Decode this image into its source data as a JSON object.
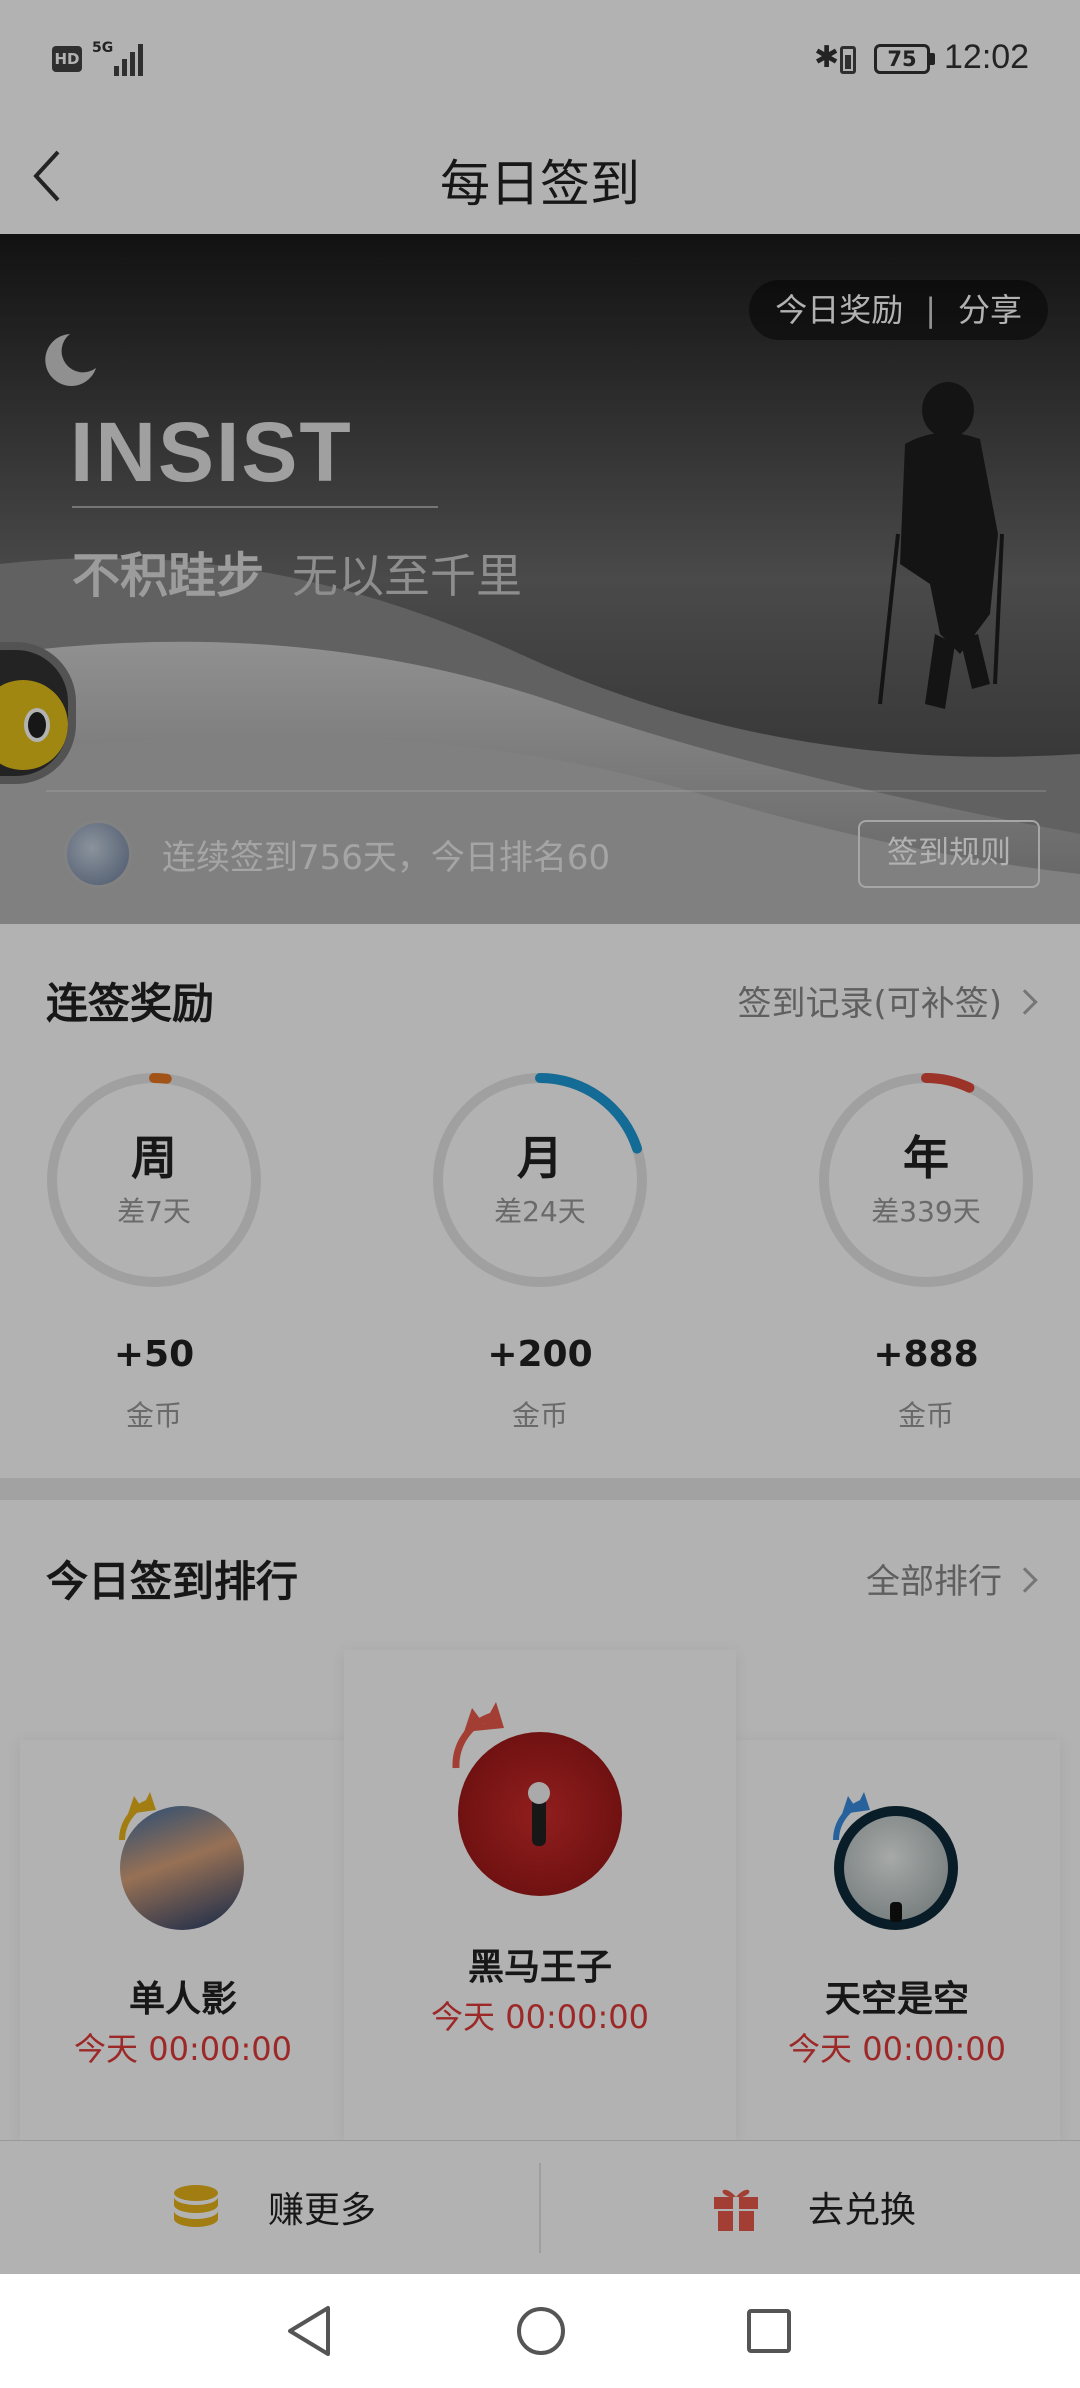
{
  "status_bar": {
    "hd": "HD",
    "network": "5G",
    "battery": "75",
    "time": "12:02"
  },
  "header": {
    "title": "每日签到"
  },
  "banner": {
    "today_reward": "今日奖励",
    "divider": "|",
    "share": "分享",
    "headline": "INSIST",
    "slogan_main": "不积跬步",
    "slogan_sub": "无以至千里",
    "streak_text": "连续签到756天，今日排名60",
    "rules_button": "签到规则"
  },
  "rewards": {
    "title": "连签奖励",
    "link": "签到记录(可补签)",
    "items": [
      {
        "label": "周",
        "remaining": "差7天",
        "amount": "+50",
        "unit": "金币",
        "progress": 0.02,
        "color": "#e87722"
      },
      {
        "label": "月",
        "remaining": "差24天",
        "amount": "+200",
        "unit": "金币",
        "progress": 0.2,
        "color": "#1e9ad6"
      },
      {
        "label": "年",
        "remaining": "差339天",
        "amount": "+888",
        "unit": "金币",
        "progress": 0.07,
        "color": "#e04a3a"
      }
    ]
  },
  "ranking": {
    "title": "今日签到排行",
    "link": "全部排行",
    "entries": [
      {
        "rank": 2,
        "name": "单人影",
        "time": "今天 00:00:00",
        "crown_color": "#e8b31a"
      },
      {
        "rank": 1,
        "name": "黑马王子",
        "time": "今天 00:00:00",
        "crown_color": "#e85a4a"
      },
      {
        "rank": 3,
        "name": "天空是空",
        "time": "今天 00:00:00",
        "crown_color": "#3a8de0"
      }
    ]
  },
  "bottom_bar": {
    "earn": "赚更多",
    "exchange": "去兑换"
  },
  "icons": {
    "back": "chevron-left-icon",
    "earn": "coins-icon",
    "exchange": "gift-icon",
    "nav_back": "triangle-back-icon",
    "nav_home": "circle-home-icon",
    "nav_recent": "square-recent-icon"
  }
}
